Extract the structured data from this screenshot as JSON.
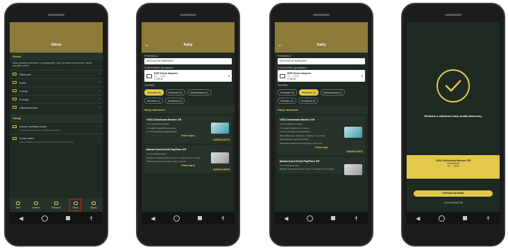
{
  "phone1": {
    "title": "Oferta",
    "section_title": "Oferta",
    "note": "Nowe produkty bankowe na wyciągnięcie ręki! Sprawdź naszą ofertę i zalicz wszystko online.",
    "menu": [
      {
        "label": "Rachunki",
        "icon": "wallet-icon"
      },
      {
        "label": "Karty",
        "icon": "card-icon"
      },
      {
        "label": "Lokaty",
        "icon": "piggy-icon"
      },
      {
        "label": "Kredyty",
        "icon": "cash-icon"
      },
      {
        "label": "Ubezpieczenia",
        "icon": "umbrella-icon"
      }
    ],
    "services_title": "Usługi",
    "services": [
      {
        "label": "Kantor wymiany walut",
        "sub": "Szybka wymiana walut w Twojej bankowości"
      },
      {
        "label": "Kursy walut",
        "sub": "Tabela aktualnych kursów kupna i sprzedaży walut obcych"
      }
    ],
    "tabs": [
      "Start",
      "Finanse",
      "Płatności",
      "Oferta",
      "Więcej"
    ],
    "active_tab": "Oferta"
  },
  "phone2": {
    "title": "Karty",
    "product_label": "POSIADACZ",
    "product_value": "KRZYSZTOF NAROŻNY",
    "account_label": "Z RACHUNKU (posiadacz)",
    "account_name": "ROR Konto Aktywne",
    "account_number": "12 ... 1234",
    "account_balance": "1 234 zł",
    "card_type_label": "Typ karty",
    "chips": [
      "Wszystkie (8)",
      "Debetowe (5)",
      "Wielowalutowe (1)",
      "Wirtualne (1)",
      "Kredytowe (2)"
    ],
    "active_chip": "Wszystkie (8)",
    "section": "Karty debetowe",
    "cards": [
      {
        "name": "VISA Debetowa Bardzo XR",
        "bullets": [
          "0 zł miesięcznie za kartę",
          "0 zł opłaty miesięcznej za kartę",
          "0 zł za transakcje bezgotówkowe"
        ],
        "link": "Pokaż więcej",
        "cta": "ZAMÓW KARTĘ"
      },
      {
        "name": "MasterCard Debit PayPass XR",
        "bullets": [
          "0 zł za wydanie karty",
          "Wypłaty w bankomatach w Polsce i za granicą bez prowizji",
          "Możliwość płacenia kartą na całym świecie"
        ],
        "link": "Pokaż więcej",
        "cta": "ZAMÓW KARTĘ"
      }
    ]
  },
  "phone3": {
    "title": "Karty",
    "active_chip": "Debetowe (5)",
    "card_bullets": [
      "0 zł miesięcznie za kartę",
      "0 zł opłaty miesięcznej za kartę",
      "0 zł za transakcje bezgotówkowe",
      "Płać zbliżeniowo telefonem w Polsce i za granicą",
      "Wielowalutowa karta debetowa",
      "Możliwość dodania do Google Pay, Apple Pay"
    ],
    "link": "Pokaż mniej",
    "cta": "ZAMÓW KARTĘ"
  },
  "phone4": {
    "message": "Wniosek o założenie karty został utworzony",
    "card_name": "VISA Debetowa Bardzo XR",
    "card_sub": "Nr wniosku",
    "card_number": "12 ... 1234",
    "home_button": "STRONA GŁÓWNA",
    "list_link": "LISTA WNIOSKÓW"
  },
  "colors": {
    "accent": "#e4c84a",
    "header": "#8c7a3a",
    "bg": "#1e2a22",
    "highlight": "#e01818"
  }
}
